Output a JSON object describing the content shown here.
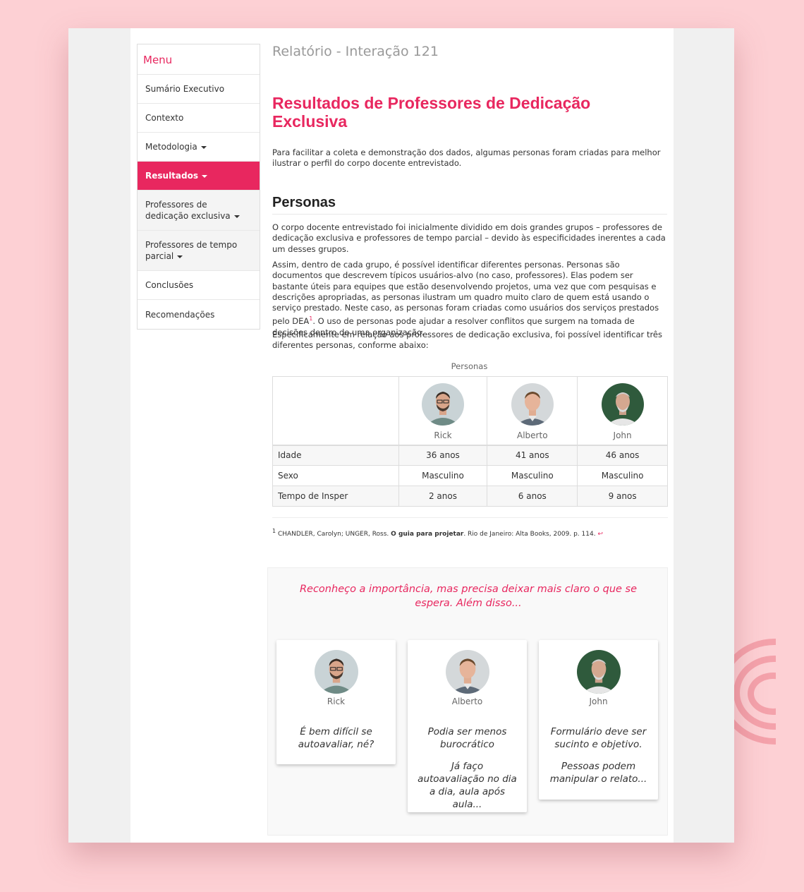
{
  "menu": {
    "title": "Menu",
    "items": [
      {
        "label": "Sumário Executivo"
      },
      {
        "label": "Contexto"
      },
      {
        "label": "Metodologia"
      },
      {
        "label": "Resultados"
      },
      {
        "label": "Professores de dedicação exclusiva"
      },
      {
        "label": "Professores de tempo parcial"
      },
      {
        "label": "Conclusões"
      },
      {
        "label": "Recomendações"
      }
    ]
  },
  "report_title": "Relatório - Interação 121",
  "section_title": "Resultados de Professores de Dedicação Exclusiva",
  "intro": "Para facilitar a coleta e demonstração dos dados, algumas personas foram criadas para melhor ilustrar o perfil do corpo docente entrevistado.",
  "personas_heading": "Personas",
  "p1": "O corpo docente entrevistado foi inicialmente dividido em dois grandes grupos – professores de dedicação exclusiva e professores de tempo parcial – devido às especificidades inerentes a cada um desses grupos.",
  "p2_a": "Assim, dentro de cada grupo, é possível identificar diferentes personas. Personas são documentos que descrevem típicos usuários-alvo (no caso, professores). Elas podem ser bastante úteis para equipes que estão desenvolvendo projetos, uma vez que com pesquisas e descrições apropriadas, as personas ilustram um quadro muito claro de quem está usando o serviço prestado. Neste caso, as personas foram criadas como usuários dos serviços prestados pelo DEA",
  "p2_ref": "1",
  "p2_b": ". O uso de personas pode ajudar a resolver conflitos que surgem na tomada de decisões dentro de uma organização.",
  "p3": "Especificamente em relação aos professores de dedicação exclusiva, foi possível identificar três diferentes personas, conforme abaixo:",
  "table": {
    "caption": "Personas",
    "personas": [
      "Rick",
      "Alberto",
      "John"
    ],
    "rows": [
      {
        "label": "Idade",
        "values": [
          "36 anos",
          "41 anos",
          "46 anos"
        ]
      },
      {
        "label": "Sexo",
        "values": [
          "Masculino",
          "Masculino",
          "Masculino"
        ]
      },
      {
        "label": "Tempo de Insper",
        "values": [
          "2 anos",
          "6 anos",
          "9 anos"
        ]
      }
    ]
  },
  "footnote": {
    "num": "1",
    "pre": "CHANDLER, Carolyn; UNGER, Ross. ",
    "bold": "O guia para projetar",
    "post": ". Rio de Janeiro: Alta Books, 2009. p. 114.",
    "back": "↩"
  },
  "feedback": {
    "quote": "Reconheço a importância, mas precisa deixar mais claro o que se espera. Além disso...",
    "cards": [
      {
        "name": "Rick",
        "q1": "É bem difícil se autoavaliar, né?",
        "q2": ""
      },
      {
        "name": "Alberto",
        "q1": "Podia ser menos burocrático",
        "q2": "Já faço autoavaliação no dia a dia, aula após aula..."
      },
      {
        "name": "John",
        "q1": "Formulário deve ser sucinto e objetivo.",
        "q2": "Pessoas podem manipular o relato..."
      }
    ]
  },
  "colors": {
    "accent": "#e8275f",
    "background": "#fdd0d4"
  }
}
